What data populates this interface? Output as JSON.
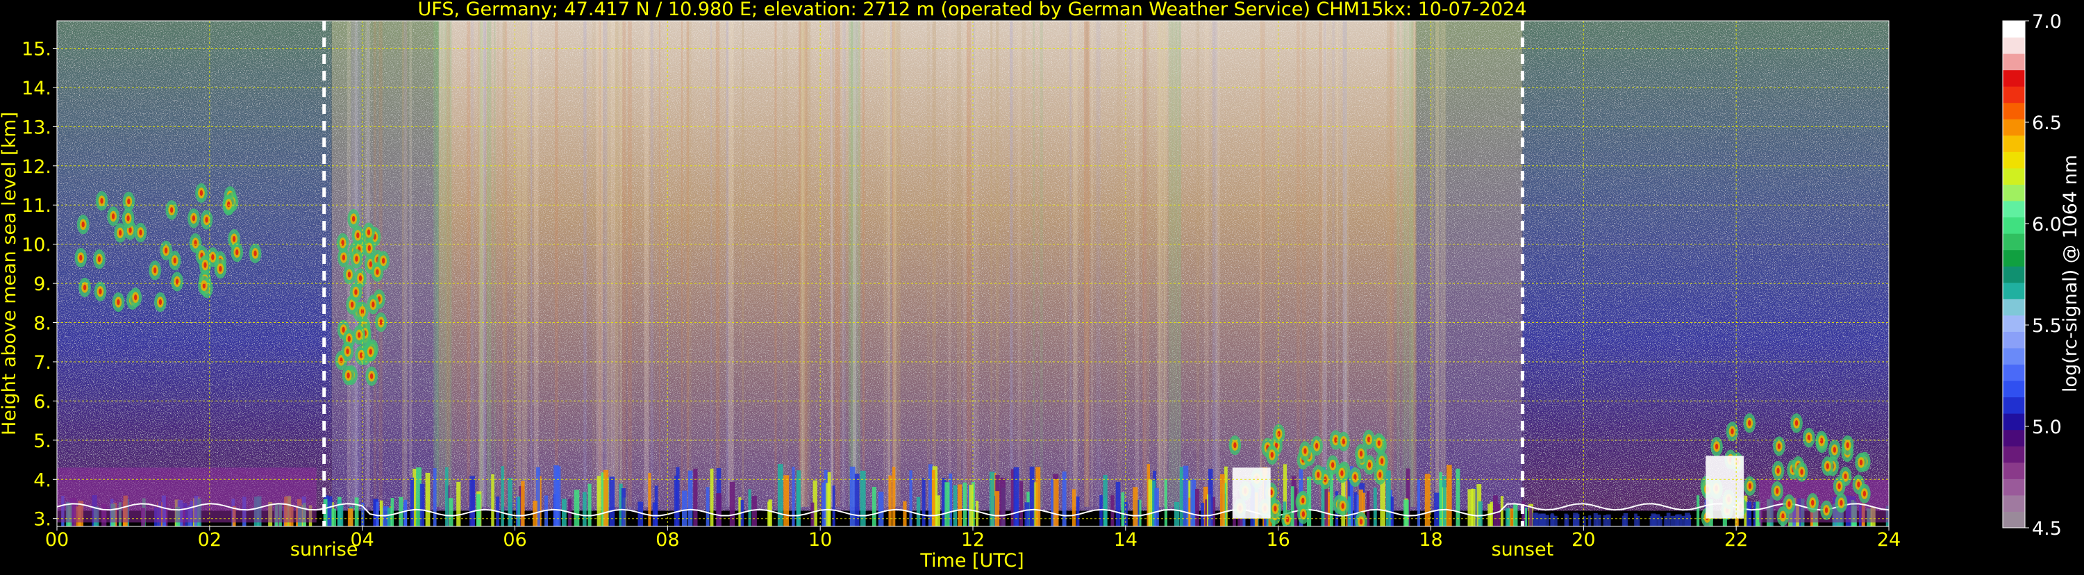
{
  "chart_data": {
    "type": "heatmap",
    "title": "UFS, Germany; 47.417 N / 10.980 E; elevation: 2712 m  (operated by German Weather Service)    CHM15kx: 10-07-2024",
    "xlabel": "Time [UTC]",
    "ylabel": "Height above mean sea level [km]",
    "xlim": [
      0,
      24
    ],
    "ylim": [
      2.8,
      15.7
    ],
    "xticks": [
      "00",
      "02",
      "04",
      "06",
      "08",
      "10",
      "12",
      "14",
      "16",
      "18",
      "20",
      "22",
      "24"
    ],
    "xtick_values": [
      0,
      2,
      4,
      6,
      8,
      10,
      12,
      14,
      16,
      18,
      20,
      22,
      24
    ],
    "yticks": [
      "3.",
      "4.",
      "5.",
      "6.",
      "7.",
      "8.",
      "9.",
      "10.",
      "11.",
      "12.",
      "13.",
      "14.",
      "15."
    ],
    "ytick_values": [
      3,
      4,
      5,
      6,
      7,
      8,
      9,
      10,
      11,
      12,
      13,
      14,
      15
    ],
    "grid": true,
    "markers": [
      {
        "label": "sunrise",
        "x": 3.5
      },
      {
        "label": "sunset",
        "x": 19.2
      }
    ],
    "colorbar": {
      "label": "log(rc-signal) @ 1064 nm",
      "range": [
        4.5,
        7.0
      ],
      "ticks": [
        "4.5",
        "5.0",
        "5.5",
        "6.0",
        "6.5",
        "7.0"
      ],
      "tick_values": [
        4.5,
        5.0,
        5.5,
        6.0,
        6.5,
        7.0
      ],
      "colors": [
        "#9a8a9a",
        "#a07aa0",
        "#9a5a9a",
        "#8a3a8a",
        "#6a1a7a",
        "#4a0a7a",
        "#2010a0",
        "#2030d0",
        "#3050f0",
        "#4a6af8",
        "#6a8af8",
        "#8aa0f8",
        "#a0b8f8",
        "#80c8d8",
        "#20b0a0",
        "#109070",
        "#10a040",
        "#30c060",
        "#40e080",
        "#60f0a0",
        "#a0f060",
        "#d0f020",
        "#f0e000",
        "#f8c000",
        "#f89000",
        "#f86000",
        "#f03010",
        "#e01010",
        "#f0a0a0",
        "#f8e0e0",
        "#ffffff"
      ]
    },
    "cloud_layers": [
      {
        "name_hint": "cirrus",
        "t_start": 0.2,
        "t_end": 2.6,
        "h_low": 8.5,
        "h_high": 11.4
      },
      {
        "name_hint": "cirrus",
        "t_start": 3.7,
        "t_end": 4.3,
        "h_low": 6.5,
        "h_high": 10.8
      },
      {
        "name_hint": "low cloud",
        "t_start": 15.3,
        "t_end": 17.4,
        "h_low": 2.9,
        "h_high": 5.2
      },
      {
        "name_hint": "low cloud",
        "t_start": 21.5,
        "t_end": 23.9,
        "h_low": 3.0,
        "h_high": 5.5
      }
    ]
  },
  "colors": {
    "text": "#ffff00",
    "grid": "#e6e600",
    "colorbar_text": "#ffffff"
  }
}
